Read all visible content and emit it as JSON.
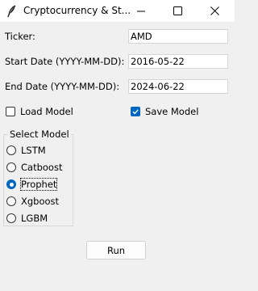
{
  "window": {
    "title": "Cryptocurrency & St...",
    "icon": "feather-icon",
    "controls": [
      "minimize-icon",
      "maximize-icon",
      "close-icon"
    ]
  },
  "form": {
    "ticker_label": "Ticker:",
    "ticker_value": "AMD",
    "start_label": "Start Date (YYYY-MM-DD):",
    "start_value": "2016-05-22",
    "end_label": "End Date (YYYY-MM-DD):",
    "end_value": "2024-06-22"
  },
  "options": {
    "load_model_label": "Load Model",
    "load_model_checked": false,
    "save_model_label": "Save Model",
    "save_model_checked": true
  },
  "model_group": {
    "title": "Select Model",
    "models": [
      "LSTM",
      "Catboost",
      "Prophet",
      "Xgboost",
      "LGBM"
    ],
    "selected": "Prophet"
  },
  "run_label": "Run",
  "colors": {
    "accent": "#0067c0",
    "background": "#f0f0f0",
    "titlebar": "#ffffff"
  }
}
